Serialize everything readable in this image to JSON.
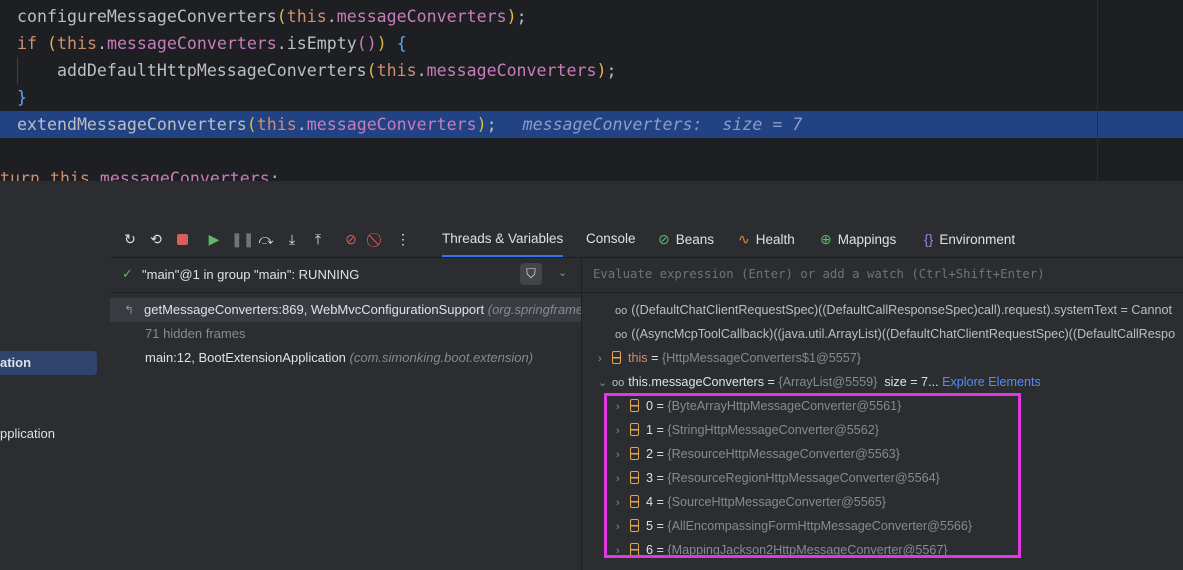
{
  "editor": {
    "lines": [
      {
        "segments": [
          {
            "t": "configureMessageConverters",
            "c": "pn"
          },
          {
            "t": "(",
            "c": "br"
          },
          {
            "t": "this",
            "c": "kw"
          },
          {
            "t": ".",
            "c": "pn"
          },
          {
            "t": "messageConverters",
            "c": "fld"
          },
          {
            "t": ")",
            "c": "br"
          },
          {
            "t": ";",
            "c": "pn"
          }
        ]
      },
      {
        "segments": [
          {
            "t": "if ",
            "c": "kw"
          },
          {
            "t": "(",
            "c": "br"
          },
          {
            "t": "this",
            "c": "kw"
          },
          {
            "t": ".",
            "c": "pn"
          },
          {
            "t": "messageConverters",
            "c": "fld"
          },
          {
            "t": ".isEmpty",
            "c": "pn"
          },
          {
            "t": "()",
            "c": "br2"
          },
          {
            "t": ") ",
            "c": "br"
          },
          {
            "t": "{",
            "c": "br3"
          }
        ]
      },
      {
        "segments": [
          {
            "t": "    addDefaultHttpMessageConverters",
            "c": "pn"
          },
          {
            "t": "(",
            "c": "br"
          },
          {
            "t": "this",
            "c": "kw"
          },
          {
            "t": ".",
            "c": "pn"
          },
          {
            "t": "messageConverters",
            "c": "fld"
          },
          {
            "t": ")",
            "c": "br"
          },
          {
            "t": ";",
            "c": "pn"
          }
        ]
      },
      {
        "segments": [
          {
            "t": "}",
            "c": "br3"
          }
        ]
      },
      {
        "segments": [
          {
            "t": "extendMessageConverters",
            "c": "pn"
          },
          {
            "t": "(",
            "c": "br"
          },
          {
            "t": "this",
            "c": "kw"
          },
          {
            "t": ".",
            "c": "pn"
          },
          {
            "t": "messageConverters",
            "c": "fld"
          },
          {
            "t": ")",
            "c": "br"
          },
          {
            "t": ";",
            "c": "pn"
          }
        ]
      },
      {
        "segments": []
      },
      {
        "segments": [
          {
            "t": "turn ",
            "c": "kw"
          },
          {
            "t": "this",
            "c": "kw"
          },
          {
            "t": ".",
            "c": "pn"
          },
          {
            "t": "messageConverters",
            "c": "fld"
          },
          {
            "t": ";",
            "c": "pn"
          }
        ]
      }
    ],
    "inline_hint": "messageConverters:  size = 7"
  },
  "left_strip": {
    "selected_label": "ation",
    "app_label": "pplication"
  },
  "toolbar": {
    "icons": [
      "rerun-icon",
      "restart-icon",
      "stop-icon",
      "resume-icon",
      "pause-icon",
      "step-over-icon",
      "step-into-icon",
      "step-out-icon",
      "breakpoints-icon",
      "mute-breakpoints-icon",
      "more-icon"
    ],
    "tabs": {
      "threads": "Threads & Variables",
      "console": "Console",
      "beans": "Beans",
      "health": "Health",
      "mappings": "Mappings",
      "environment": "Environment"
    },
    "colors": {
      "accent": "#3574f0"
    }
  },
  "threads": {
    "thread_label": "\"main\"@1 in group \"main\": RUNNING",
    "frames": [
      {
        "method": "getMessageConverters:869, WebMvcConfigurationSupport",
        "pkg": "(org.springframework.web.servlet.config.annotation)"
      },
      {
        "method": "71 hidden frames",
        "pkg": ""
      },
      {
        "method": "main:12, BootExtensionApplication",
        "pkg": "(com.simonking.boot.extension)"
      }
    ]
  },
  "variables": {
    "eval_placeholder": "Evaluate expression (Enter) or add a watch (Ctrl+Shift+Enter)",
    "watches": [
      "((DefaultChatClientRequestSpec)((DefaultCallResponseSpec)call).request).systemText = Cannot",
      "((AsyncMcpToolCallback)((java.util.ArrayList)((DefaultChatClientRequestSpec)((DefaultCallRespo"
    ],
    "this_row": {
      "name": "this",
      "value": "{HttpMessageConverters$1@5557}"
    },
    "list_row": {
      "name": "this.messageConverters",
      "value": "{ArrayList@5559}",
      "size": "size = 7...",
      "link": "Explore Elements"
    },
    "elements": [
      {
        "index": "0",
        "value": "{ByteArrayHttpMessageConverter@5561}"
      },
      {
        "index": "1",
        "value": "{StringHttpMessageConverter@5562}"
      },
      {
        "index": "2",
        "value": "{ResourceHttpMessageConverter@5563}"
      },
      {
        "index": "3",
        "value": "{ResourceRegionHttpMessageConverter@5564}"
      },
      {
        "index": "4",
        "value": "{SourceHttpMessageConverter@5565}"
      },
      {
        "index": "5",
        "value": "{AllEncompassingFormHttpMessageConverter@5566}"
      },
      {
        "index": "6",
        "value": "{MappingJackson2HttpMessageConverter@5567}"
      }
    ],
    "highlight_color": "#e138e1"
  }
}
